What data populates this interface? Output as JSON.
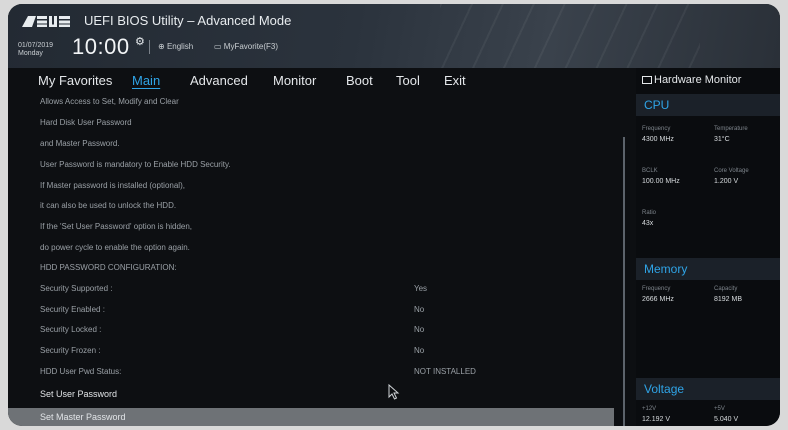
{
  "header": {
    "app_title": "UEFI BIOS Utility – Advanced Mode",
    "date": "01/07/2019",
    "day": "Monday",
    "time": "10:00",
    "language": "English",
    "favorites": "MyFavorite(F3)"
  },
  "nav": {
    "tabs": [
      "My Favorites",
      "Main",
      "Advanced",
      "Monitor",
      "Boot",
      "Tool",
      "Exit"
    ],
    "active": "Main"
  },
  "main": {
    "description_lines": [
      "Allows Access to Set, Modify and Clear",
      "Hard Disk   User   Password",
      "and   Master   Password.",
      "User Password is mandatory to Enable HDD Security.",
      "If Master password is installed (optional),",
      "it can also be used to unlock the HDD.",
      "If the 'Set User Password' option is hidden,",
      "do power cycle to enable the option again."
    ],
    "section_heading": "HDD PASSWORD CONFIGURATION:",
    "settings": [
      {
        "label": "Security Supported :",
        "value": "Yes"
      },
      {
        "label": "Security Enabled   :",
        "value": "No"
      },
      {
        "label": "Security Locked    :",
        "value": "No"
      },
      {
        "label": "Security Frozen    :",
        "value": "No"
      },
      {
        "label": "HDD User Pwd Status:",
        "value": "NOT INSTALLED"
      }
    ],
    "actions": [
      "Set User Password",
      "Set Master Password"
    ]
  },
  "hardware_monitor": {
    "title": "Hardware Monitor",
    "cpu": {
      "heading": "CPU",
      "frequency_label": "Frequency",
      "frequency": "4300 MHz",
      "temperature_label": "Temperature",
      "temperature": "31°C",
      "bclk_label": "BCLK",
      "bclk": "100.00 MHz",
      "core_voltage_label": "Core Voltage",
      "core_voltage": "1.200 V",
      "ratio_label": "Ratio",
      "ratio": "43x"
    },
    "memory": {
      "heading": "Memory",
      "frequency_label": "Frequency",
      "frequency": "2666 MHz",
      "capacity_label": "Capacity",
      "capacity": "8192 MB"
    },
    "voltage": {
      "heading": "Voltage",
      "v12_label": "+12V",
      "v12": "12.192 V",
      "v5_label": "+5V",
      "v5": "5.040 V"
    }
  },
  "colors": {
    "accent": "#2fa4e7",
    "selection": "#6e7276",
    "background": "#0d0f12"
  },
  "icons": [
    "asus-logo",
    "gear-icon",
    "globe-icon",
    "favorites-icon",
    "monitor-icon",
    "mouse-cursor-icon"
  ]
}
